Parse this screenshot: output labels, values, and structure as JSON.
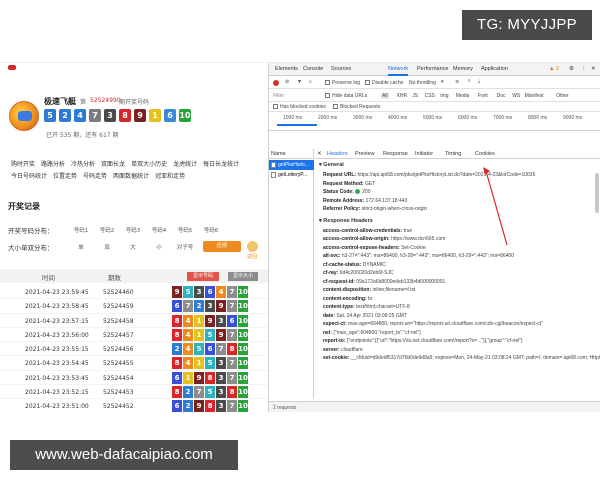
{
  "overlay": {
    "tg_badge": "TG: MYYJJPP",
    "watermark": "www.web-dafacaipiao.com"
  },
  "lottery": {
    "name": "极速飞艇",
    "issue_label": "第",
    "issue_number": "52524990",
    "issue_tail": "期开奖号码",
    "balls": [
      {
        "num": "5",
        "color": "#2e7bd6"
      },
      {
        "num": "2",
        "color": "#2e7bd6"
      },
      {
        "num": "4",
        "color": "#2e7bd6"
      },
      {
        "num": "7",
        "color": "#7c7c7c"
      },
      {
        "num": "3",
        "color": "#4b4b4b"
      },
      {
        "num": "8",
        "color": "#d9262b"
      },
      {
        "num": "9",
        "color": "#7a2121"
      },
      {
        "num": "1",
        "color": "#e6c01e"
      },
      {
        "num": "6",
        "color": "#3a8ad9"
      },
      {
        "num": "10",
        "color": "#27a33a"
      }
    ],
    "stats": "已开 535 期，还有 617 期"
  },
  "nav": {
    "row1": [
      "购时开奖",
      "路路分析",
      "冷热分析",
      "双面长龙",
      "单双大小历史",
      "龙虎统计",
      "每日长龙统计"
    ],
    "row2": [
      "今日号码统计",
      "位置走势",
      "号码走势",
      "两面数据统计",
      "冠亚和走势"
    ]
  },
  "records": {
    "title": "开奖记录",
    "filter1_label": "开奖号码分布：",
    "filter1_opts": [
      "号码1",
      "号码2",
      "号码3",
      "号码4",
      "号码5",
      "号码6"
    ],
    "filter2_label": "大小单双分布：",
    "filter2_opts": [
      "单",
      "双",
      "大",
      "小",
      "对子号"
    ],
    "reset_label": "还原",
    "side_label": "返回",
    "columns": {
      "time": "时间",
      "issue": "期数",
      "btn1": "显示号码",
      "btn2": "显示大小"
    },
    "rows": [
      {
        "time": "2021-04-23 23:59:45",
        "issue": "52524460",
        "nums": [
          "9",
          "5",
          "3",
          "6",
          "4",
          "7",
          "10"
        ]
      },
      {
        "time": "2021-04-23 23:58:45",
        "issue": "52524459",
        "nums": [
          "6",
          "7",
          "2",
          "3",
          "9",
          "7",
          "10"
        ]
      },
      {
        "time": "2021-04-23 23:57:15",
        "issue": "52524458",
        "nums": [
          "8",
          "4",
          "1",
          "9",
          "3",
          "6",
          "10"
        ]
      },
      {
        "time": "2021-04-23 23:56:00",
        "issue": "52524457",
        "nums": [
          "8",
          "4",
          "1",
          "5",
          "9",
          "7",
          "10"
        ]
      },
      {
        "time": "2021-04-23 23:55:15",
        "issue": "52524456",
        "nums": [
          "2",
          "4",
          "5",
          "6",
          "7",
          "8",
          "10"
        ]
      },
      {
        "time": "2021-04-23 23:54:45",
        "issue": "52524455",
        "nums": [
          "8",
          "4",
          "1",
          "5",
          "3",
          "7",
          "10"
        ]
      },
      {
        "time": "2021-04-23 23:53:45",
        "issue": "52524454",
        "nums": [
          "6",
          "1",
          "9",
          "8",
          "3",
          "7",
          "10"
        ]
      },
      {
        "time": "2021-04-23 23:52:15",
        "issue": "52524453",
        "nums": [
          "8",
          "2",
          "7",
          "5",
          "3",
          "8",
          "10"
        ]
      },
      {
        "time": "2021-04-23 23:51:00",
        "issue": "52524452",
        "nums": [
          "6",
          "2",
          "9",
          "8",
          "3",
          "7",
          "10"
        ]
      },
      {
        "time": "2021-04-23 23:50:15",
        "issue": "52524451",
        "nums": [
          "8",
          "4",
          "1",
          "5",
          "3",
          "7",
          "10"
        ]
      }
    ],
    "num_colors": {
      "1": "#e6c01e",
      "2": "#2e7bd6",
      "3": "#4b4b4b",
      "4": "#f08a1c",
      "5": "#2bb3c0",
      "6": "#3a4fd9",
      "7": "#8d8d8d",
      "8": "#d9262b",
      "9": "#7a2121",
      "10": "#27a33a"
    }
  },
  "devtools": {
    "tabs": [
      "Elements",
      "Console",
      "Sources",
      "Network",
      "Performance",
      "Memory",
      "Application"
    ],
    "active_tab": "Network",
    "warning_badge": "▲ 2",
    "toolbar": {
      "preserve_log": "Preserve log",
      "disable_cache": "Disable cache",
      "throttle": "No throttling"
    },
    "filter": {
      "label": "Filter",
      "hide_data": "Hide data URLs",
      "types": [
        "All",
        "XHR",
        "JS",
        "CSS",
        "Img",
        "Media",
        "Font",
        "Doc",
        "WS",
        "Manifest",
        "Other"
      ]
    },
    "filter2": {
      "blocked_cookies": "Has blocked cookies",
      "blocked_requests": "Blocked Requests"
    },
    "timeline_ticks": [
      "1000 ms",
      "2000 ms",
      "3000 ms",
      "4000 ms",
      "5000 ms",
      "6000 ms",
      "7000 ms",
      "8000 ms",
      "9000 ms"
    ],
    "name_header": "Name",
    "requests": [
      "getPksHisto...",
      "getLotteryP..."
    ],
    "detail_tabs": [
      "Headers",
      "Preview",
      "Response",
      "Initiator",
      "Timing",
      "Cookies"
    ],
    "general_title": "General",
    "general": [
      {
        "k": "Request URL:",
        "v": "https://api.api68.com/pks/getPksHistoryList.do?date=2021-4-23&lotCode=10035"
      },
      {
        "k": "Request Method:",
        "v": "GET"
      },
      {
        "k": "Status Code:",
        "v": "200"
      },
      {
        "k": "Remote Address:",
        "v": "172.64.137.18:443"
      },
      {
        "k": "Referrer Policy:",
        "v": "strict-origin-when-cross-origin"
      }
    ],
    "response_title": "Response Headers",
    "response": [
      {
        "k": "access-control-allow-credentials:",
        "v": "true"
      },
      {
        "k": "access-control-allow-origin:",
        "v": "https://www.dcn665.com"
      },
      {
        "k": "access-control-expose-headers:",
        "v": "Set-Cookie"
      },
      {
        "k": "alt-svc:",
        "v": "h3-27=\":443\"; ma=86400, h3-28=\":443\"; ma=86400, h3-29=\":443\"; ma=86400"
      },
      {
        "k": "cf-cache-status:",
        "v": "DYNAMIC"
      },
      {
        "k": "cf-ray:",
        "v": "6d4c206020d2eb6f-SJC"
      },
      {
        "k": "cf-request-id:",
        "v": "09a172a6b8000edeb133b4d000000001"
      },
      {
        "k": "content-disposition:",
        "v": "inline;filename=f.txt"
      },
      {
        "k": "content-encoding:",
        "v": "br"
      },
      {
        "k": "content-type:",
        "v": "text/html;charset=UTF-8"
      },
      {
        "k": "date:",
        "v": "Sat, 24 Apr 2021 03:08:25 GMT"
      },
      {
        "k": "expect-ct:",
        "v": "max-age=604800, report-uri=\"https://report-uri.cloudflare.com/cdn-cgi/beacon/expect-ct\""
      },
      {
        "k": "nel:",
        "v": "{\"max_age\":604800,\"report_to\":\"cf-nel\"}"
      },
      {
        "k": "report-to:",
        "v": "{\"endpoints\":[{\"url\":\"https:\\/\\/a.nel.cloudflare.com\\/report?s=...\"}],\"group\":\"cf-nel\"}"
      },
      {
        "k": "server:",
        "v": "cloudflare"
      },
      {
        "k": "set-cookie:",
        "v": "__cfduid=d9dedf5317d76b0de9d8a5; expires=Mon, 24-May-21 03:08:24 GMT; path=/; domain=.api68.com; HttpOnly; SameSite=Lax"
      }
    ],
    "footer": "2 requests"
  }
}
